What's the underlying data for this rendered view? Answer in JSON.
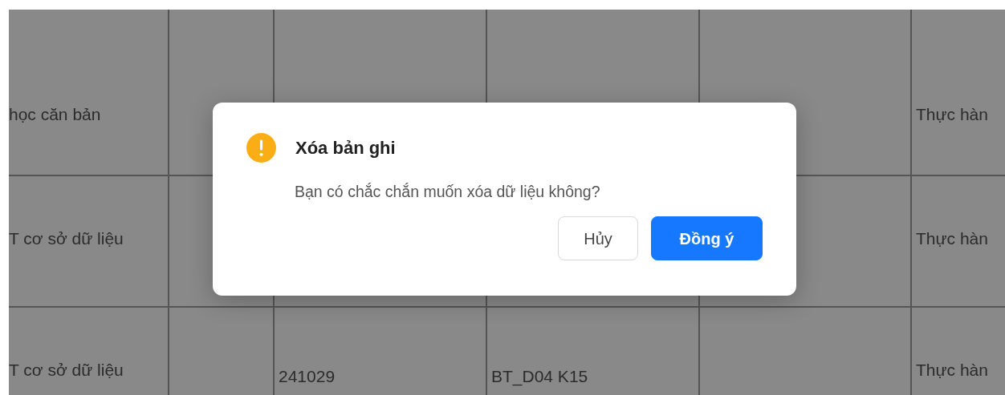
{
  "table": {
    "rows": [
      {
        "column_1": "học căn bản",
        "column_6": "Thực hàn"
      },
      {
        "column_1": "T cơ sở dữ liệu",
        "column_6": "Thực hàn"
      },
      {
        "column_1": "T cơ sở dữ liệu",
        "column_3": "241029",
        "column_4": "BT_D04 K15",
        "column_6": "Thực hàn"
      }
    ]
  },
  "dialog": {
    "title": "Xóa bản ghi",
    "message": "Bạn có chắc chắn muốn xóa dữ liệu không?",
    "buttons": [
      {
        "label": "Hủy",
        "kind": "default"
      },
      {
        "label": "Đồng ý",
        "kind": "primary"
      }
    ]
  }
}
